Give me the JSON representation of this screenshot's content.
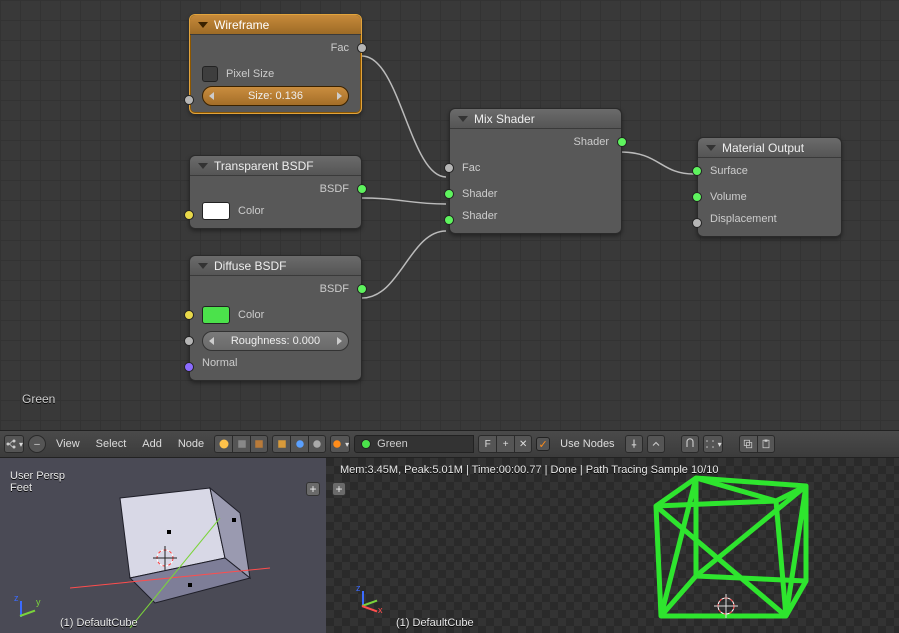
{
  "material_name": "Green",
  "nodes": {
    "wireframe": {
      "title": "Wireframe",
      "fac_label": "Fac",
      "pixel_size_label": "Pixel Size",
      "size_label": "Size: 0.136"
    },
    "transparent": {
      "title": "Transparent BSDF",
      "bsdf_label": "BSDF",
      "color_label": "Color",
      "color_hex": "#ffffff"
    },
    "diffuse": {
      "title": "Diffuse BSDF",
      "bsdf_label": "BSDF",
      "color_label": "Color",
      "color_hex": "#4be24b",
      "roughness_label": "Roughness: 0.000",
      "normal_label": "Normal"
    },
    "mix": {
      "title": "Mix Shader",
      "out_label": "Shader",
      "fac_label": "Fac",
      "shader1_label": "Shader",
      "shader2_label": "Shader"
    },
    "output": {
      "title": "Material Output",
      "surface_label": "Surface",
      "volume_label": "Volume",
      "displacement_label": "Displacement"
    }
  },
  "header": {
    "menu_view": "View",
    "menu_select": "Select",
    "menu_add": "Add",
    "menu_node": "Node",
    "material_field": "Green",
    "f_label": "F",
    "use_nodes_label": "Use Nodes"
  },
  "left_view": {
    "line1": "User Persp",
    "line2": "Feet",
    "bottom": "(1) DefaultCube"
  },
  "right_view": {
    "info": "Mem:3.45M, Peak:5.01M | Time:00:00.77 | Done | Path Tracing Sample 10/10",
    "bottom": "(1) DefaultCube"
  }
}
